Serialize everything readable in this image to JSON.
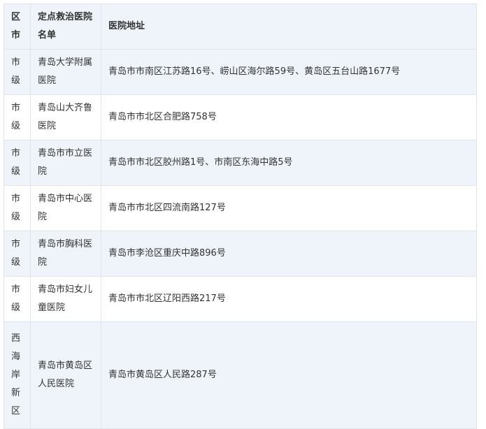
{
  "table": {
    "headers": [
      "区市",
      "定点救治医院名单",
      "医院地址"
    ],
    "rows": [
      {
        "district": "市级",
        "hospital": "青岛大学附属医院",
        "address": "青岛市市南区江苏路16号、崂山区海尔路59号、黄岛区五台山路1677号"
      },
      {
        "district": "市级",
        "hospital": "青岛山大齐鲁医院",
        "address": "青岛市市北区合肥路758号"
      },
      {
        "district": "市级",
        "hospital": "青岛市市立医院",
        "address": "青岛市市北区胶州路1号、市南区东海中路5号"
      },
      {
        "district": "市级",
        "hospital": "青岛市中心医院",
        "address": "青岛市市北区四流南路127号"
      },
      {
        "district": "市级",
        "hospital": "青岛市胸科医院",
        "address": "青岛市李沧区重庆中路896号"
      },
      {
        "district": "市级",
        "hospital": "青岛市妇女儿童医院",
        "address": "青岛市市北区辽阳西路217号"
      },
      {
        "district": "西海岸新区",
        "hospital": "青岛市黄岛区人民医院",
        "address": "青岛市黄岛区人民路287号"
      }
    ]
  }
}
